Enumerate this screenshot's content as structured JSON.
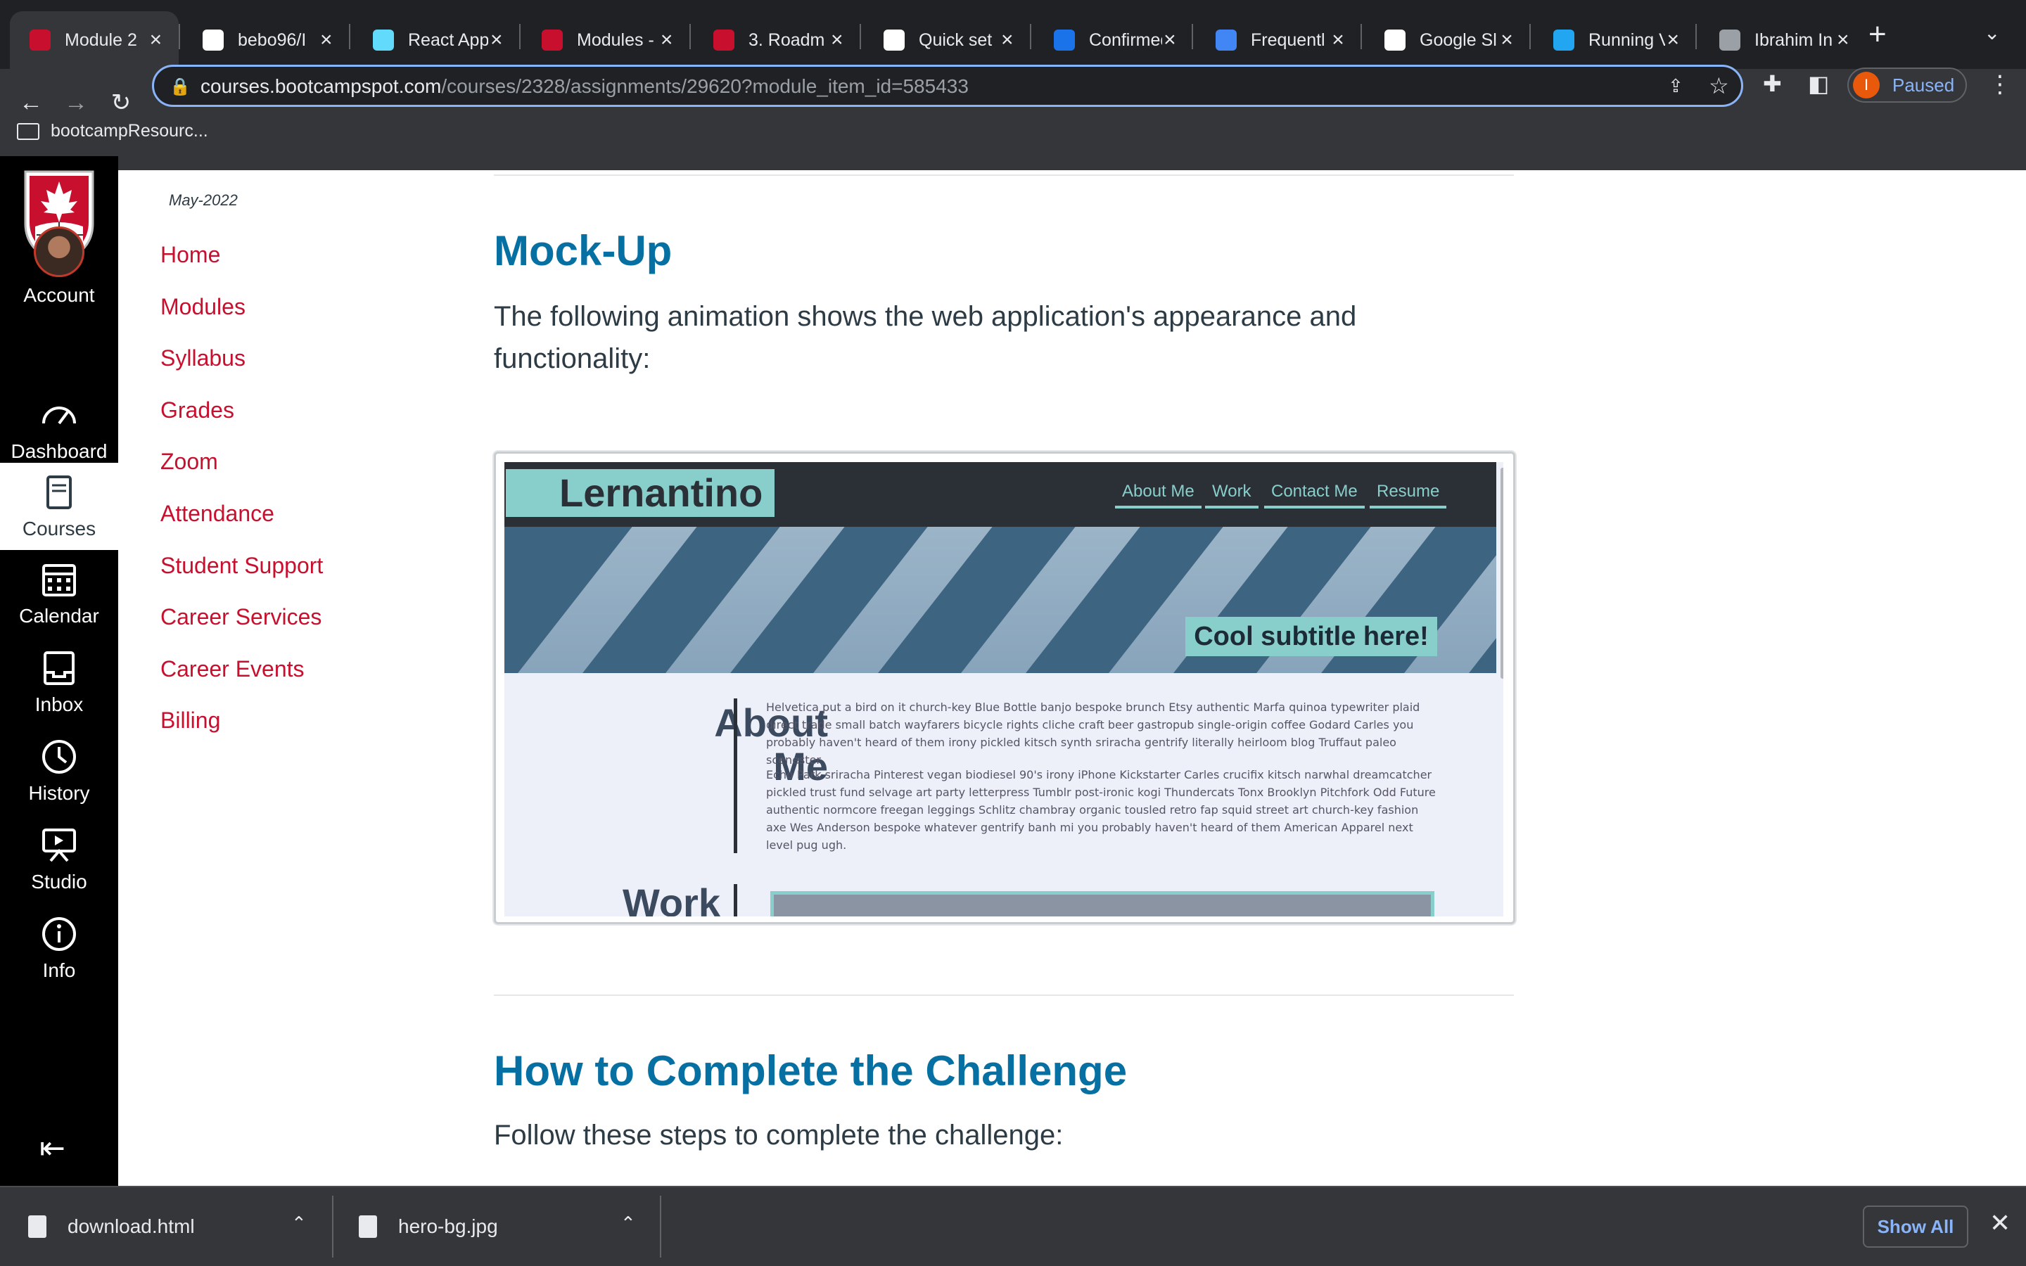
{
  "browser": {
    "tabs": [
      {
        "title": "Module 2",
        "fav_color": "#c8102e",
        "active": true
      },
      {
        "title": "bebo96/I",
        "fav_color": "#ffffff"
      },
      {
        "title": "React App",
        "fav_color": "#61dafb"
      },
      {
        "title": "Modules -",
        "fav_color": "#c8102e"
      },
      {
        "title": "3. Roadm",
        "fav_color": "#c8102e"
      },
      {
        "title": "Quick set",
        "fav_color": "#ffffff"
      },
      {
        "title": "Confirmed",
        "fav_color": "#1a73e8"
      },
      {
        "title": "Frequentl",
        "fav_color": "#4285f4"
      },
      {
        "title": "Google Sl",
        "fav_color": "#ffffff"
      },
      {
        "title": "Running V",
        "fav_color": "#22a6f2"
      },
      {
        "title": "Ibrahim In",
        "fav_color": "#9aa0a6"
      }
    ],
    "url_host": "courses.bootcampspot.com",
    "url_path": "/courses/2328/assignments/29620?module_item_id=585433",
    "profile_initial": "I",
    "profile_status": "Paused",
    "bookmark": "bootcampResourc..."
  },
  "global_nav": {
    "items": [
      {
        "label": "Account",
        "icon": "avatar"
      },
      {
        "label": "Dashboard",
        "icon": "dashboard-icon"
      },
      {
        "label": "Courses",
        "icon": "courses-icon",
        "active": true
      },
      {
        "label": "Calendar",
        "icon": "calendar-icon"
      },
      {
        "label": "Inbox",
        "icon": "inbox-icon"
      },
      {
        "label": "History",
        "icon": "history-icon"
      },
      {
        "label": "Studio",
        "icon": "studio-icon"
      },
      {
        "label": "Info",
        "icon": "info-icon"
      }
    ]
  },
  "course_nav": {
    "term": "May-2022",
    "links": [
      "Home",
      "Modules",
      "Syllabus",
      "Grades",
      "Zoom",
      "Attendance",
      "Student Support",
      "Career Services",
      "Career Events",
      "Billing"
    ]
  },
  "content": {
    "mockup_heading": "Mock-Up",
    "mockup_text": "The following animation shows the web application's appearance and functionality:",
    "challenge_heading": "How to Complete the Challenge",
    "challenge_text": "Follow these steps to complete the challenge:"
  },
  "mockup": {
    "brand": "Lernantino",
    "nav": [
      "About Me",
      "Work",
      "Contact Me",
      "Resume"
    ],
    "subtitle": "Cool subtitle here!",
    "about_heading_1": "About",
    "about_heading_2": "Me",
    "para1": "Helvetica put a bird on it church-key Blue Bottle banjo bespoke brunch Etsy authentic Marfa quinoa typewriter plaid direct trade small batch wayfarers bicycle rights cliche craft beer gastropub single-origin coffee Godard Carles you probably haven't heard of them irony pickled kitsch synth sriracha gentrify literally heirloom blog Truffaut paleo scenester",
    "para2": "Echo Park sriracha Pinterest vegan biodiesel 90's irony iPhone Kickstarter Carles crucifix kitsch narwhal dreamcatcher pickled trust fund selvage art party letterpress Tumblr post-ironic kogi Thundercats Tonx Brooklyn Pitchfork Odd Future authentic normcore freegan leggings Schlitz chambray organic tousled retro fap squid street art church-key fashion axe Wes Anderson bespoke whatever gentrify banh mi you probably haven't heard of them American Apparel next level pug ugh.",
    "work_heading": "Work"
  },
  "downloads": {
    "items": [
      "download.html",
      "hero-bg.jpg"
    ],
    "show_all": "Show All"
  }
}
